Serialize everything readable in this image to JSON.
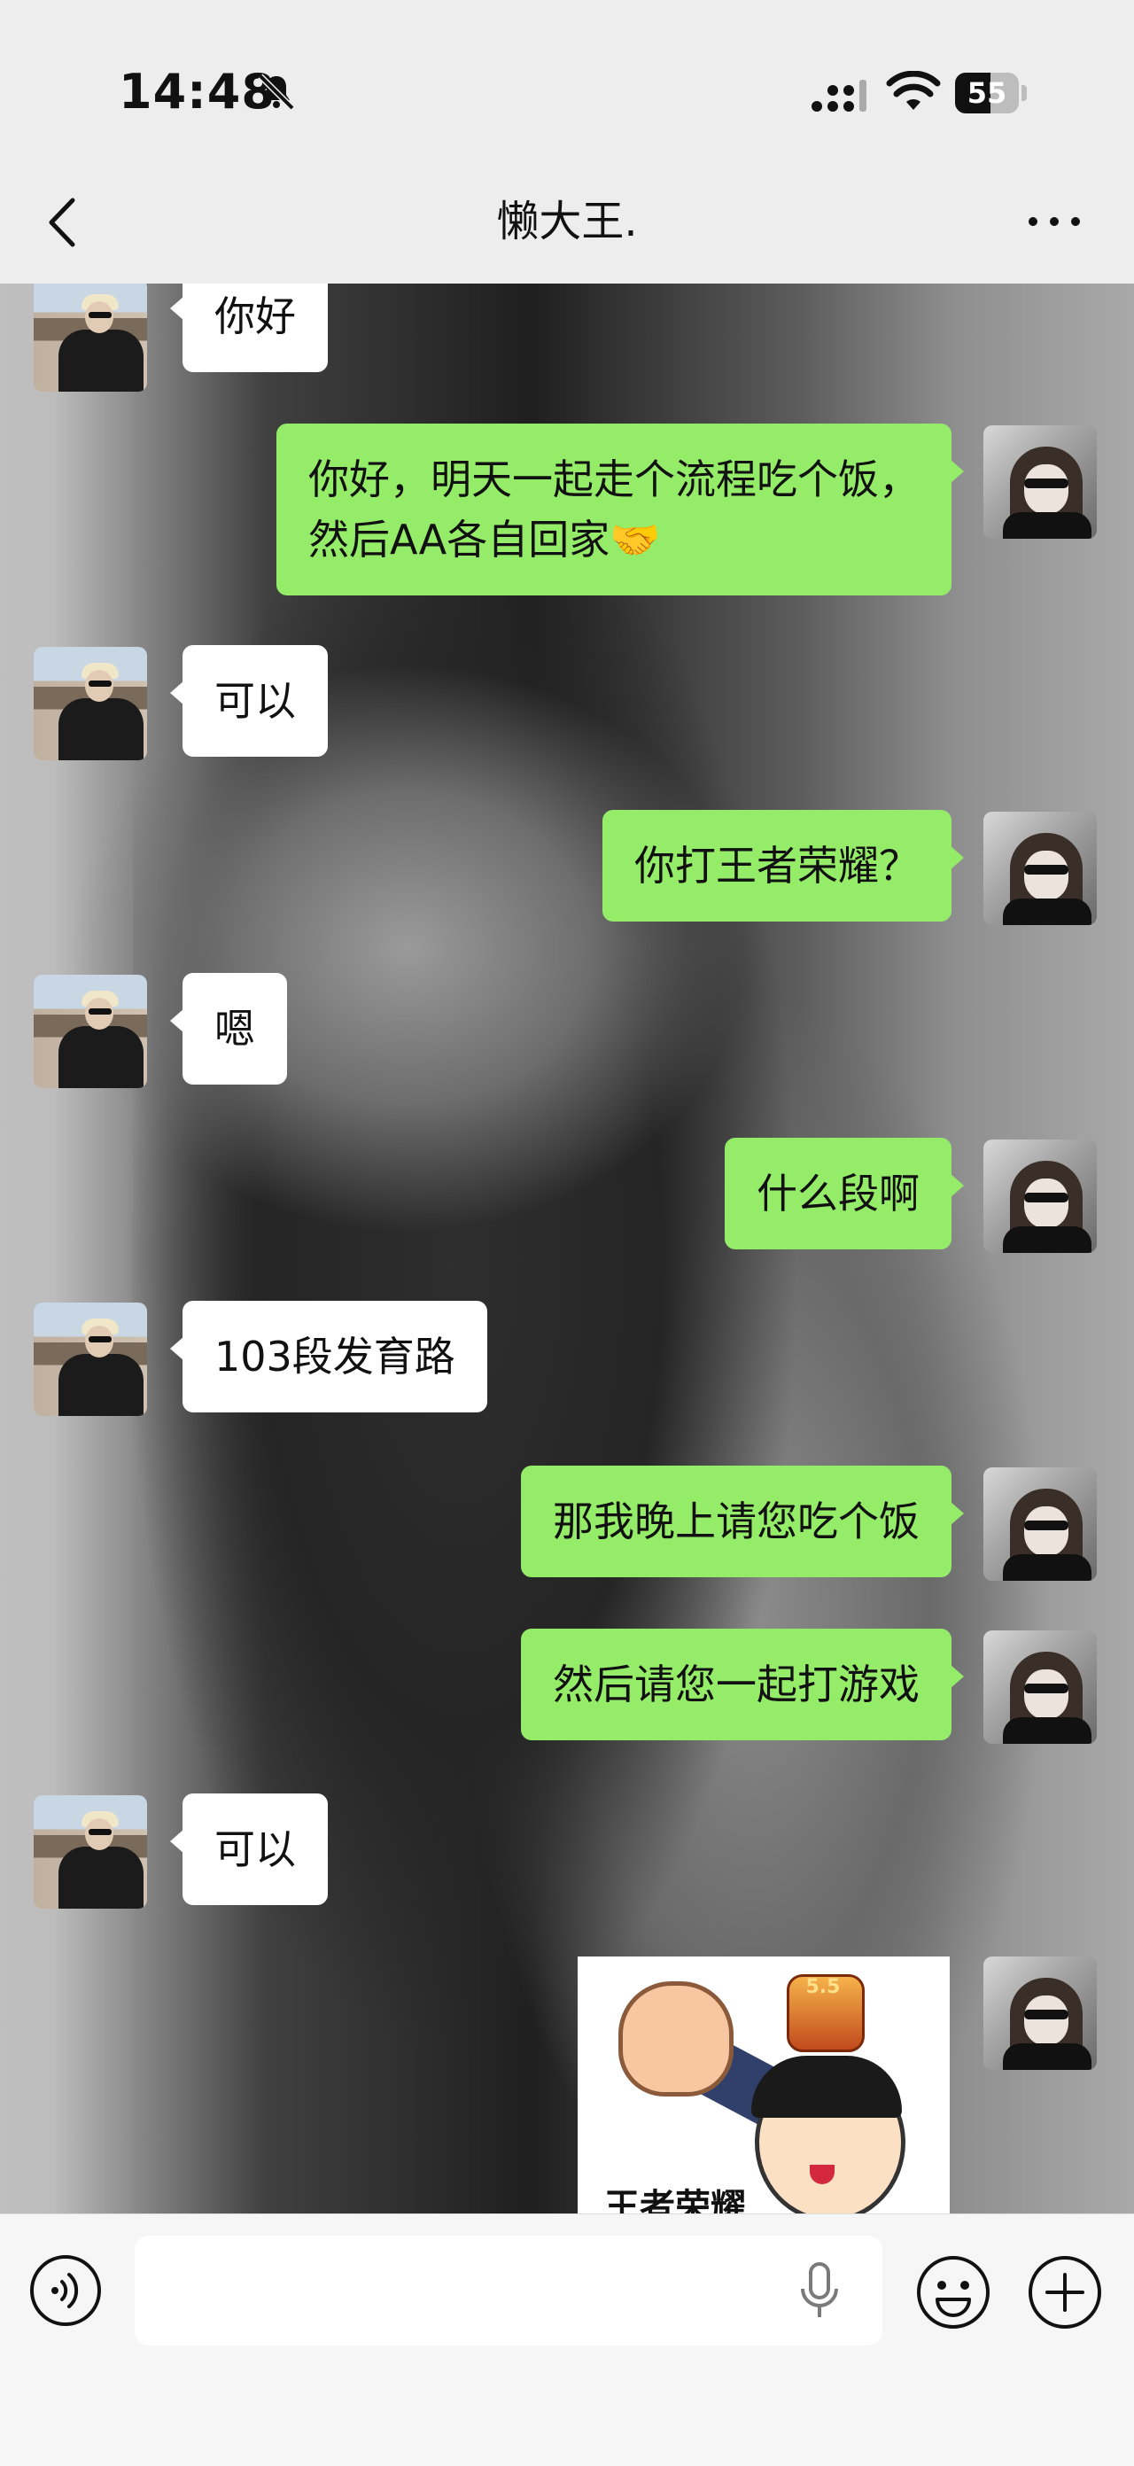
{
  "status_bar": {
    "time": "14:48",
    "battery": "55",
    "battery_level": 0.55
  },
  "nav": {
    "title": "懒大王."
  },
  "messages": [
    {
      "side": "other",
      "text": "你好"
    },
    {
      "side": "me",
      "text": "你好，明天一起走个流程吃个饭，\n然后AA各自回家🤝"
    },
    {
      "side": "other",
      "text": "可以"
    },
    {
      "side": "me",
      "text": "你打王者荣耀？"
    },
    {
      "side": "other",
      "text": "嗯"
    },
    {
      "side": "me",
      "text": "什么段啊"
    },
    {
      "side": "other",
      "text": "103段发育路"
    },
    {
      "side": "me",
      "text": "那我晚上请您吃个饭"
    },
    {
      "side": "me",
      "text": "然后请您一起打游戏"
    },
    {
      "side": "other",
      "text": "可以"
    },
    {
      "side": "me",
      "type": "sticker",
      "caption": "王者荣耀",
      "badge": "5.5"
    }
  ],
  "input": {
    "value": "",
    "placeholder": ""
  },
  "icons": {
    "back": "chevron-left-icon",
    "more": "more-horizontal-icon",
    "voice": "voice-icon",
    "mic": "microphone-icon",
    "emoji": "emoji-icon",
    "plus": "plus-icon"
  },
  "colors": {
    "my_bubble": "#95ec69",
    "other_bubble": "#ffffff",
    "bar_bg": "#ededed"
  }
}
